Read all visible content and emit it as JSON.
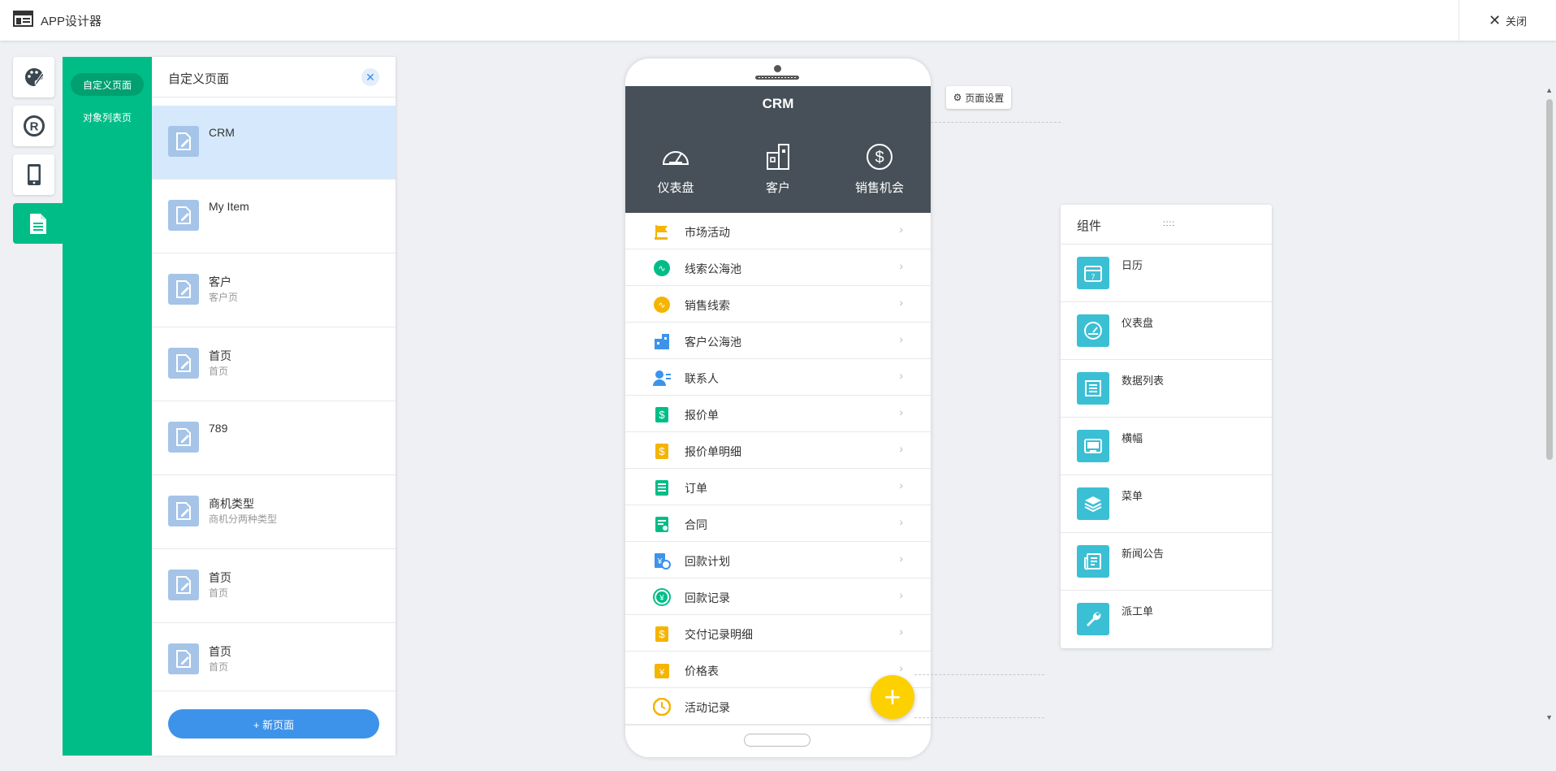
{
  "topbar": {
    "title": "APP设计器",
    "close_label": "关闭"
  },
  "tools": [
    {
      "name": "palette-icon"
    },
    {
      "name": "registered-icon"
    },
    {
      "name": "phone-icon"
    },
    {
      "name": "document-icon",
      "active": true
    }
  ],
  "side_nav": {
    "items": [
      {
        "label": "自定义页面",
        "active": true
      },
      {
        "label": "对象列表页",
        "active": false
      }
    ]
  },
  "page_panel": {
    "title": "自定义页面",
    "pages": [
      {
        "name": "CRM",
        "sub": "",
        "selected": true
      },
      {
        "name": "My Item",
        "sub": ""
      },
      {
        "name": "客户",
        "sub": "客户页"
      },
      {
        "name": "首页",
        "sub": "首页"
      },
      {
        "name": "789",
        "sub": ""
      },
      {
        "name": "商机类型",
        "sub": "商机分两种类型"
      },
      {
        "name": "首页",
        "sub": "首页"
      },
      {
        "name": "首页",
        "sub": "首页"
      }
    ],
    "new_page_label": "+ 新页面"
  },
  "phone": {
    "title": "CRM",
    "shortcuts": [
      {
        "label": "仪表盘",
        "icon": "gauge-icon"
      },
      {
        "label": "客户",
        "icon": "building-icon"
      },
      {
        "label": "销售机会",
        "icon": "dollar-icon"
      }
    ],
    "menu": [
      {
        "label": "市场活动",
        "icon": "flag-icon",
        "color": "#f5b400"
      },
      {
        "label": "线索公海池",
        "icon": "leads-pool-icon",
        "color": "#00bd87"
      },
      {
        "label": "销售线索",
        "icon": "leads-icon",
        "color": "#f5b400"
      },
      {
        "label": "客户公海池",
        "icon": "customer-pool-icon",
        "color": "#3d93ea"
      },
      {
        "label": "联系人",
        "icon": "contact-icon",
        "color": "#3d93ea"
      },
      {
        "label": "报价单",
        "icon": "quote-icon",
        "color": "#00bd87"
      },
      {
        "label": "报价单明细",
        "icon": "quote-detail-icon",
        "color": "#f5b400"
      },
      {
        "label": "订单",
        "icon": "order-icon",
        "color": "#00bd87"
      },
      {
        "label": "合同",
        "icon": "contract-icon",
        "color": "#00bd87"
      },
      {
        "label": "回款计划",
        "icon": "payment-plan-icon",
        "color": "#3d93ea"
      },
      {
        "label": "回款记录",
        "icon": "payment-record-icon",
        "color": "#00bd87"
      },
      {
        "label": "交付记录明细",
        "icon": "delivery-icon",
        "color": "#f5b400"
      },
      {
        "label": "价格表",
        "icon": "price-list-icon",
        "color": "#f5b400"
      },
      {
        "label": "活动记录",
        "icon": "activity-icon",
        "color": "#f5b400"
      }
    ],
    "arrow": "›"
  },
  "page_settings_label": "页面设置",
  "components": {
    "title": "组件",
    "drag_handle": "::::",
    "items": [
      {
        "label": "日历",
        "icon": "calendar-icon"
      },
      {
        "label": "仪表盘",
        "icon": "dashboard-icon"
      },
      {
        "label": "数据列表",
        "icon": "data-list-icon"
      },
      {
        "label": "横幅",
        "icon": "banner-icon"
      },
      {
        "label": "菜单",
        "icon": "menu-layers-icon"
      },
      {
        "label": "新闻公告",
        "icon": "news-icon"
      },
      {
        "label": "派工单",
        "icon": "wrench-icon"
      }
    ]
  },
  "colors": {
    "brand_green": "#00bd87",
    "accent_blue": "#3d93ea",
    "fab_yellow": "#fdd000",
    "phone_header": "#475058",
    "component_teal": "#3bbfd4"
  }
}
